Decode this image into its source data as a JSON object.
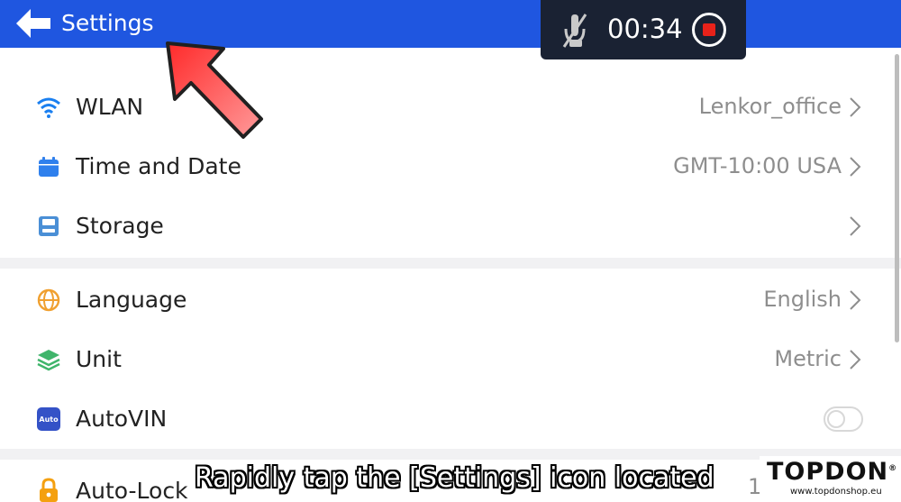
{
  "header": {
    "title": "Settings",
    "back_icon": "back-arrow-icon"
  },
  "recorder": {
    "time": "00:34",
    "mic_icon": "mic-off-icon",
    "stop_icon": "stop-record-icon",
    "stop_color": "#e8221a"
  },
  "settings": {
    "group1": [
      {
        "label": "WLAN",
        "value": "Lenkor_office",
        "icon": "wifi-icon"
      },
      {
        "label": "Time and Date",
        "value": "GMT-10:00 USA",
        "icon": "calendar-icon"
      },
      {
        "label": "Storage",
        "value": "",
        "icon": "storage-icon"
      }
    ],
    "group2": [
      {
        "label": "Language",
        "value": "English",
        "icon": "globe-icon"
      },
      {
        "label": "Unit",
        "value": "Metric",
        "icon": "layers-icon"
      },
      {
        "label": "AutoVIN",
        "value": "",
        "icon": "autovin-icon",
        "toggle": false,
        "badge": "Auto"
      }
    ],
    "group3": [
      {
        "label": "Auto-Lock",
        "value": "1",
        "icon": "lock-icon"
      }
    ]
  },
  "overlay": {
    "subtitle": "Rapidly tap the [Settings] icon located"
  },
  "brand": {
    "logo": "TOPDON",
    "registered": "®",
    "url": "www.topdonshop.eu"
  },
  "colors": {
    "header_bg": "#1f56e0",
    "wifi": "#1a7ff0",
    "calendar": "#2f80ed",
    "storage": "#4a8fd6",
    "globe": "#f0a030",
    "layers": "#3fb56b",
    "autovin": "#3452c7",
    "lock": "#f4a010"
  }
}
